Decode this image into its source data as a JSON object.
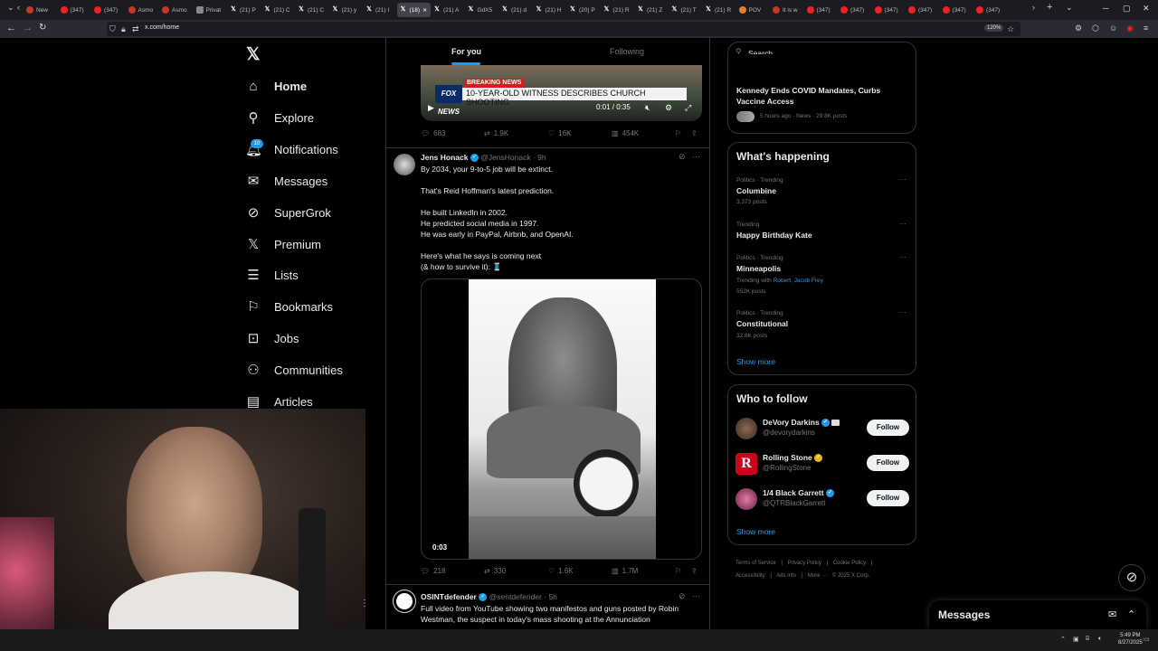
{
  "browser": {
    "tabs": [
      {
        "label": "New",
        "icon": "red"
      },
      {
        "label": "(347)",
        "icon": "yt"
      },
      {
        "label": "(347)",
        "icon": "yt"
      },
      {
        "label": "Asmo",
        "icon": "red"
      },
      {
        "label": "Asmo",
        "icon": "red"
      },
      {
        "label": "Privat",
        "icon": "priv"
      },
      {
        "label": "(21) P",
        "icon": "x"
      },
      {
        "label": "(21) C",
        "icon": "x"
      },
      {
        "label": "(21) C",
        "icon": "x"
      },
      {
        "label": "(21) y",
        "icon": "x"
      },
      {
        "label": "(21) I",
        "icon": "x"
      },
      {
        "label": "(18)",
        "icon": "x",
        "active": true
      },
      {
        "label": "(21) A",
        "icon": "x"
      },
      {
        "label": "GdX5",
        "icon": "x"
      },
      {
        "label": "(21) d",
        "icon": "x"
      },
      {
        "label": "(21) H",
        "icon": "x"
      },
      {
        "label": "(20) P",
        "icon": "x"
      },
      {
        "label": "(21) R",
        "icon": "x"
      },
      {
        "label": "(21) Z",
        "icon": "x"
      },
      {
        "label": "(21) T",
        "icon": "x"
      },
      {
        "label": "(21) R",
        "icon": "x"
      },
      {
        "label": "POV",
        "icon": "orange"
      },
      {
        "label": "It is w",
        "icon": "red"
      },
      {
        "label": "(347)",
        "icon": "yt"
      },
      {
        "label": "(347)",
        "icon": "yt"
      },
      {
        "label": "(347)",
        "icon": "yt"
      },
      {
        "label": "(347)",
        "icon": "yt"
      },
      {
        "label": "(347)",
        "icon": "yt"
      },
      {
        "label": "(347)",
        "icon": "yt"
      }
    ],
    "url": "x.com/home",
    "zoom": "120%"
  },
  "sidebar": {
    "items": [
      {
        "label": "Home",
        "icon": "home-icon",
        "glyph": "⌂"
      },
      {
        "label": "Explore",
        "icon": "search-icon",
        "glyph": "⚲"
      },
      {
        "label": "Notifications",
        "icon": "bell-icon",
        "glyph": "🔔︎"
      },
      {
        "label": "Messages",
        "icon": "envelope-icon",
        "glyph": "✉"
      },
      {
        "label": "SuperGrok",
        "icon": "grok-icon",
        "glyph": "⊘"
      },
      {
        "label": "Premium",
        "icon": "x-logo-icon",
        "glyph": "𝕏"
      },
      {
        "label": "Lists",
        "icon": "list-icon",
        "glyph": "☰"
      },
      {
        "label": "Bookmarks",
        "icon": "bookmark-icon",
        "glyph": "⚐"
      },
      {
        "label": "Jobs",
        "icon": "briefcase-icon",
        "glyph": "⊡"
      },
      {
        "label": "Communities",
        "icon": "people-icon",
        "glyph": "⚇"
      },
      {
        "label": "Articles",
        "icon": "article-icon",
        "glyph": "▤"
      }
    ],
    "notification_badge": "10"
  },
  "feed": {
    "tabs": {
      "for_you": "For you",
      "following": "Following"
    },
    "post1": {
      "video_breaking": "BREAKING NEWS",
      "video_headline": "10-YEAR-OLD WITNESS DESCRIBES CHURCH SHOOTING",
      "video_logo": "FOX NEWS",
      "video_time": "0:01 / 0:35",
      "replies": "683",
      "reposts": "1.9K",
      "likes": "16K",
      "views": "454K"
    },
    "post2": {
      "name": "Jens Honack",
      "handle": "@JensHonack",
      "time": "· 9h",
      "lines": [
        "By 2034, your 9-to-5 job will be extinct.",
        "",
        "That's Reid Hoffman's latest prediction.",
        "",
        "He built LinkedIn in 2002.",
        "He predicted social media in 1997.",
        "He was early in PayPal, Airbnb, and OpenAI.",
        "",
        "Here's what he says is coming next",
        "(& how to survive it): 🧵"
      ],
      "media_duration": "0:03",
      "replies": "218",
      "reposts": "330",
      "likes": "1.6K",
      "views": "1.7M"
    },
    "post3": {
      "name": "OSINTdefender",
      "handle": "@sentdefender",
      "time": "· 5h",
      "lines": [
        "Full video from YouTube showing two manifestos and guns posted by Robin",
        "Westman, the suspect in today's mass shooting at the Annunciation"
      ]
    }
  },
  "search": {
    "placeholder": "Search"
  },
  "news_card": {
    "title_line1": "Kennedy Ends COVID Mandates, Curbs",
    "title_line2": "Vaccine Access",
    "meta": "5 hours ago · News · 29.8K posts"
  },
  "happening": {
    "heading": "What's happening",
    "trends": [
      {
        "meta": "Politics · Trending",
        "title": "Columbine",
        "count": "3,373 posts"
      },
      {
        "meta": "Trending",
        "title": "Happy Birthday Kate",
        "count": ""
      },
      {
        "meta": "Politics · Trending",
        "title": "Minneapolis",
        "extra_prefix": "Trending with ",
        "extra_link": "Robert, Jacob Frey",
        "count": "552K posts"
      },
      {
        "meta": "Politics · Trending",
        "title": "Constitutional",
        "count": "32.6K posts"
      }
    ],
    "show_more": "Show more"
  },
  "who_to_follow": {
    "heading": "Who to follow",
    "accounts": [
      {
        "name": "DeVory Darkins",
        "handle": "@devorydarkins",
        "badge": "blue",
        "avatar_color": "#5a4636"
      },
      {
        "name": "Rolling Stone",
        "handle": "@RollingStone",
        "badge": "gold",
        "avatar_color": "#d0021b"
      },
      {
        "name": "1/4 Black Garrett",
        "handle": "@QTRBlackGarrett",
        "badge": "blue",
        "avatar_color": "#b5487a"
      }
    ],
    "follow_label": "Follow",
    "show_more": "Show more"
  },
  "footer": {
    "links": [
      "Terms of Service",
      "|",
      "Privacy Policy",
      "|",
      "Cookie Policy",
      "|",
      "Accessibility",
      "|",
      "Ads info",
      "|",
      "More ···",
      "© 2025 X Corp."
    ]
  },
  "messages_drawer": {
    "title": "Messages"
  },
  "taskbar": {
    "time": "5:49 PM",
    "date": "8/27/2025"
  }
}
